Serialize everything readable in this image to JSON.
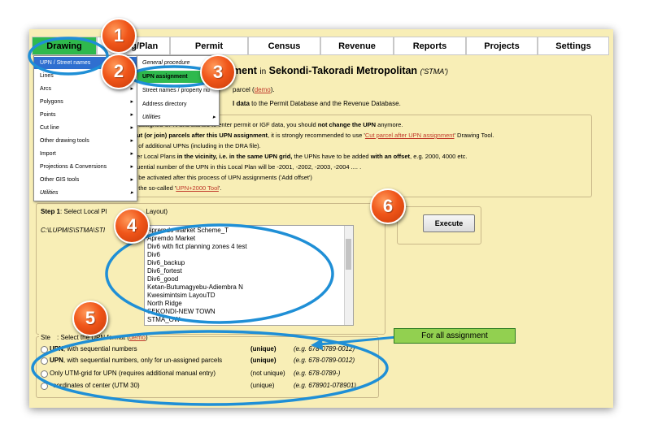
{
  "nav": {
    "tabs": [
      "Drawing",
      "Local Plan/Layout",
      "Permit",
      "Census",
      "Revenue",
      "Reports",
      "Projects",
      "Settings"
    ],
    "tab2_visible_text": "ting/Plan",
    "active": "Drawing"
  },
  "drawing_menu": {
    "items": [
      {
        "label": "UPN / Street names",
        "has_submenu": true,
        "highlighted": true
      },
      {
        "label": "Lines",
        "has_submenu": true
      },
      {
        "label": "Arcs",
        "has_submenu": true
      },
      {
        "label": "Polygons",
        "has_submenu": true
      },
      {
        "label": "Points",
        "has_submenu": true
      },
      {
        "label": "Cut line",
        "has_submenu": true
      },
      {
        "label": "Other drawing tools",
        "has_submenu": true
      },
      {
        "label": "Import",
        "has_submenu": true
      },
      {
        "label": "Projections & Conversions",
        "has_submenu": true
      },
      {
        "label": "Other GIS tools",
        "has_submenu": true
      },
      {
        "label": "Utilities",
        "has_submenu": true,
        "italic": true
      }
    ]
  },
  "upn_submenu": {
    "items": [
      {
        "label": "General procedure",
        "italic": true
      },
      {
        "label": "UPN assignment",
        "highlighted": true
      },
      {
        "label": "Street names / property nu"
      },
      {
        "label": "Address directory"
      },
      {
        "label": "Utilities",
        "italic": true,
        "has_submenu": true
      }
    ]
  },
  "heading": {
    "title_visible": "ment",
    "in_word": "in",
    "district": "Sekondi-Takoradi Metropolitan",
    "abbr": "('STMA')"
  },
  "intro": {
    "line1_text": "parcel (",
    "line1_link": "demo",
    "line1_end": ").",
    "line2_bold": "l data",
    "line2_rest": " to the Permit Database and the Revenue Database."
  },
  "notes": {
    "l1_a": "e assigned UPN and started to enter permit or IGF data, you should ",
    "l1_b": "not change the UPN",
    "l1_c": " anymore.",
    "l2_a": "cut (or join) parcels after this UPN assignment",
    "l2_b": ", it is strongly recommended to use '",
    "l2_link": "Cut parcel after UPN assignment",
    "l2_c": "' Drawing Tool.",
    "l3": "e of additional UPNs (including in the DRA file).",
    "l4_a": "her Local Plans ",
    "l4_b": "in the vicinity, i.e. in the same UPN grid,",
    "l4_c": " the UPNs have to be added ",
    "l4_d": "with an offset",
    "l4_e": ", e.g. 2000, 4000 etc.",
    "l5": "quential number of the UPN in this Local Plan will be -2001, -2002, -2003, -2004 .... .",
    "l6": "n be activated after this process of UPN assignments ('Add offset')",
    "l7_a": "h the so-called '",
    "l7_link": "UPN+2000 Tool",
    "l7_b": "'."
  },
  "step1": {
    "title_a": "Step 1",
    "title_b": ": Select Local Pl",
    "title_c": "Layout)",
    "path": "C:\\LUPMIS\\STMA\\STI",
    "list_items": [
      "Apremdo Market Scheme_T",
      "Apremdo Market",
      "Div6 with fict planning zones 4 test",
      "Div6",
      "Div6_backup",
      "Div6_fortest",
      "Div6_good",
      "Ketan-Butumagyebu-Adiembra N",
      "Kwesimintsim LayouTD",
      "North Ridge",
      "SEKONDI-NEW TOWN",
      "STMA_OW"
    ]
  },
  "execute": {
    "label": "Execute"
  },
  "step2": {
    "title_a": "Ste",
    "title_b": ": Select the UPN format (",
    "title_link": "demo",
    "title_c": ")",
    "options": [
      {
        "bold": "UPN",
        "text": ", with sequential numbers",
        "uniq": "(unique)",
        "uniq_bold": true,
        "eg": "(e.g. 678-0789-0012)"
      },
      {
        "bold": "UPN",
        "text": ", with sequential numbers, only for un-assigned parcels",
        "uniq": "(unique)",
        "uniq_bold": true,
        "eg": "(e.g. 678-0789-0012)"
      },
      {
        "bold": "",
        "text": "Only UTM-grid for UPN (requires additional manual entry)",
        "uniq": "(not unique)",
        "uniq_bold": false,
        "eg": "(e.g. 678-0789-)"
      },
      {
        "bold": "",
        "text": "oordinates of center (UTM 30)",
        "uniq": "(unique)",
        "uniq_bold": false,
        "eg": "(e.g. 678901-078901)"
      }
    ]
  },
  "annotations": {
    "numbers": [
      "1",
      "2",
      "3",
      "4",
      "5",
      "6"
    ],
    "callout": "For all assignment",
    "colors": {
      "circle": "#f0561a",
      "ellipse": "#1f8fd6",
      "callout": "#92d050",
      "active_tab": "#2fb94d",
      "link": "#c0392b",
      "page_bg": "#f8eeb6"
    }
  }
}
